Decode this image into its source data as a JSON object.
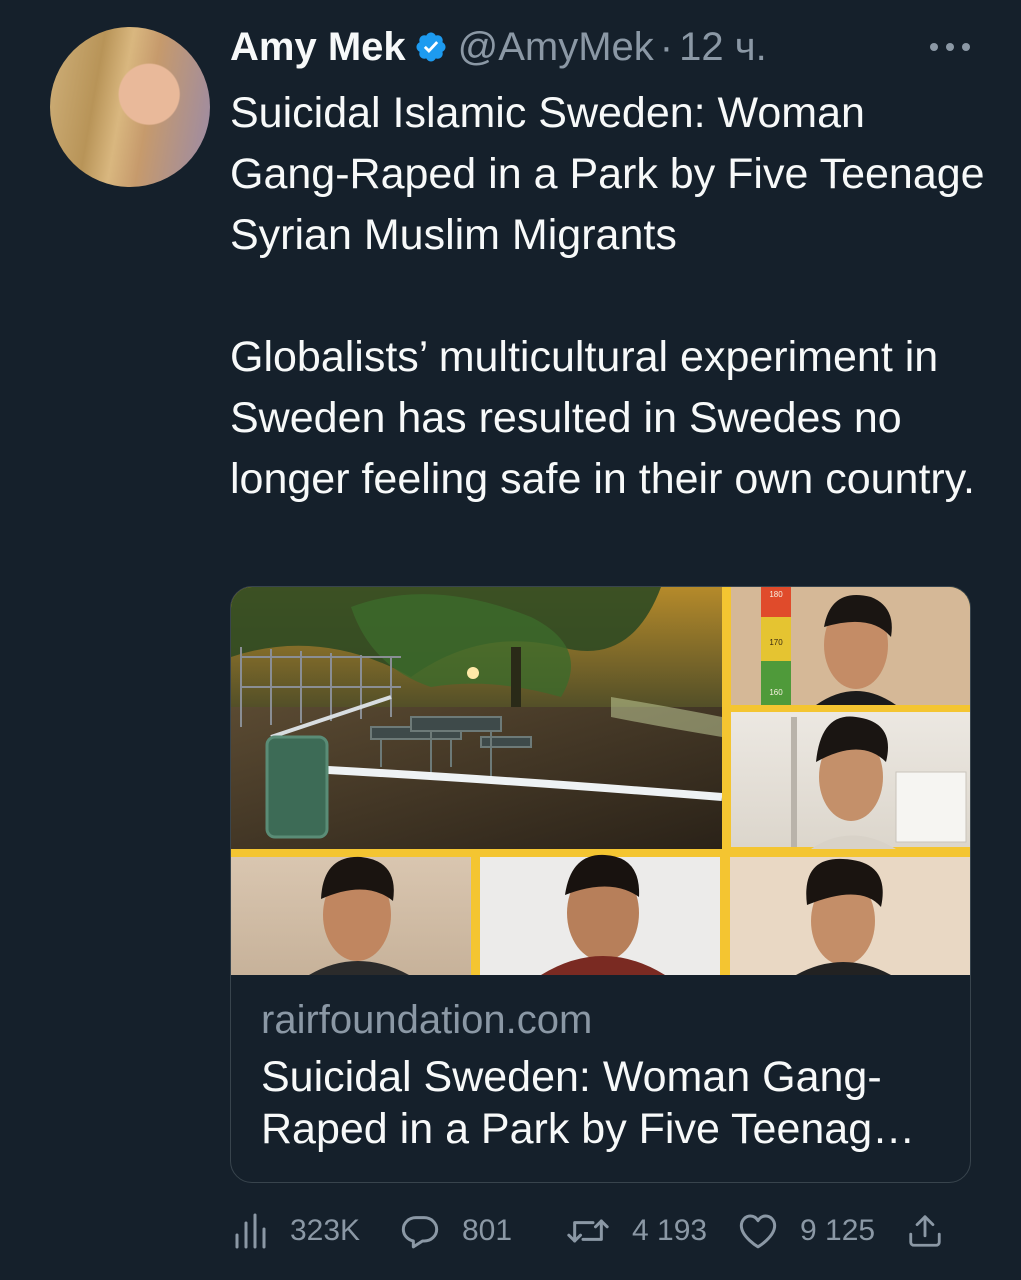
{
  "tweet": {
    "author_name": "Amy Mek",
    "handle": "@AmyMek",
    "separator": "·",
    "time": "12 ч.",
    "text": "Suicidal Islamic Sweden: Woman Gang-Raped in a Park by Five Teenage Syrian Muslim Migrants\n\nGlobalists’ multicultural experiment in Sweden has resulted in Swedes no longer feeling safe in their own country.",
    "verified": true
  },
  "card": {
    "domain": "rairfoundation.com",
    "title": "Suicidal Sweden: Woman Gang-Raped in a Park by Five Teenag…",
    "height_chart_labels": [
      "180",
      "170",
      "160"
    ]
  },
  "actions": {
    "views": "323K",
    "replies": "801",
    "retweets": "4 193",
    "likes": "9 125"
  },
  "icons": {
    "avatar": "avatar",
    "verified": "verified-badge-icon",
    "more": "more-options-icon",
    "views": "views-chart-icon",
    "reply": "reply-icon",
    "retweet": "retweet-icon",
    "like": "heart-icon",
    "share": "share-icon"
  },
  "colors": {
    "background": "#15202b",
    "text": "#f7f9f9",
    "secondary": "#8b98a5",
    "verified": "#1d9bf0",
    "card_border": "#38444d",
    "collage_frame": "#f4c531"
  }
}
